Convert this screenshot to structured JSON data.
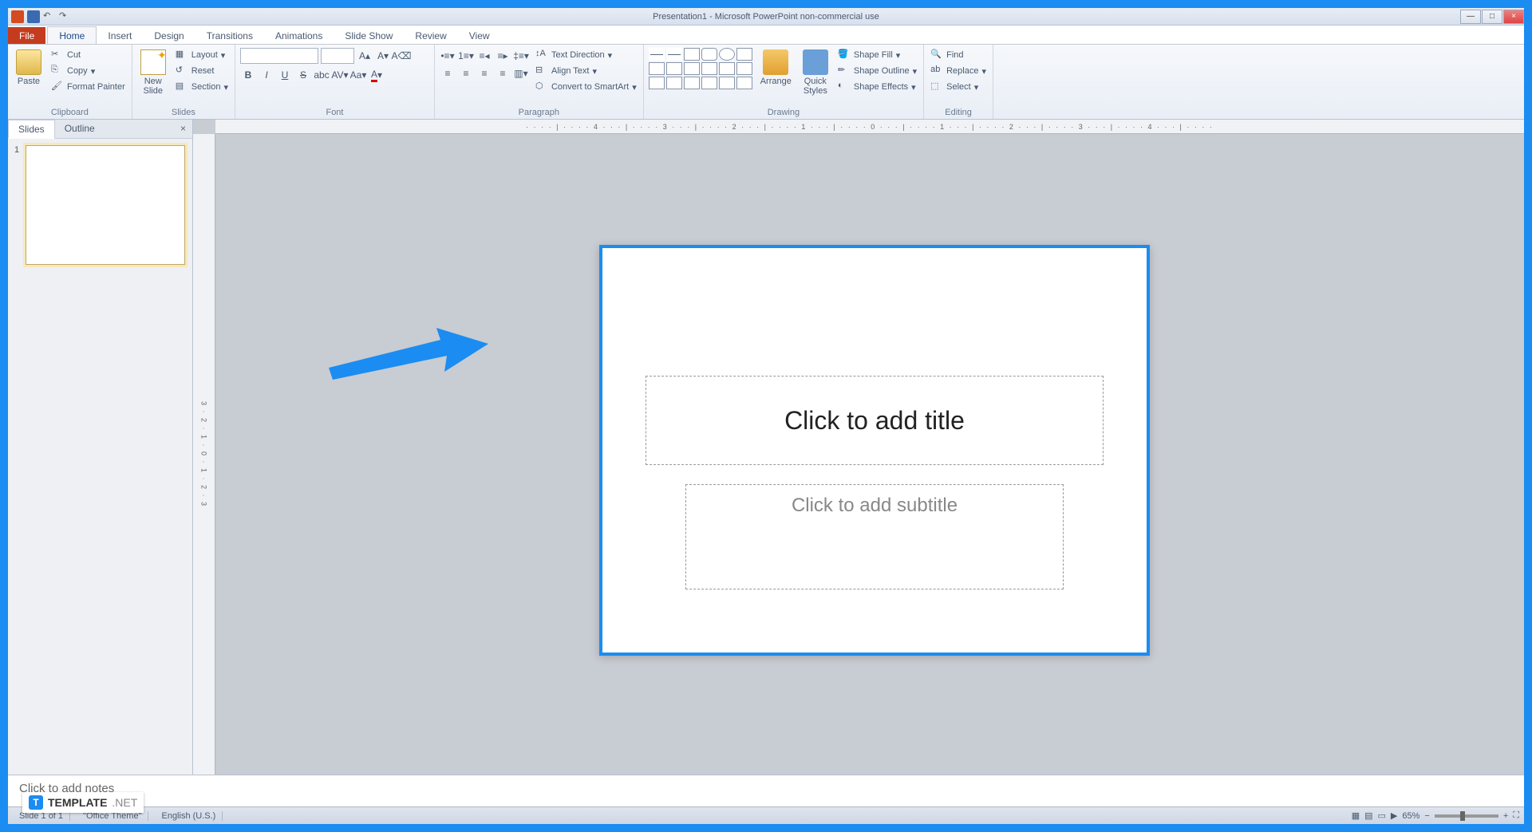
{
  "title_bar": {
    "title": "Presentation1 - Microsoft PowerPoint non-commercial use"
  },
  "tabs": {
    "file": "File",
    "items": [
      "Home",
      "Insert",
      "Design",
      "Transitions",
      "Animations",
      "Slide Show",
      "Review",
      "View"
    ],
    "active": 0
  },
  "ribbon": {
    "clipboard": {
      "title": "Clipboard",
      "paste": "Paste",
      "cut": "Cut",
      "copy": "Copy",
      "format_painter": "Format Painter"
    },
    "slides": {
      "title": "Slides",
      "new_slide": "New\nSlide",
      "layout": "Layout",
      "reset": "Reset",
      "section": "Section"
    },
    "font": {
      "title": "Font",
      "font_name": "",
      "font_size": ""
    },
    "paragraph": {
      "title": "Paragraph",
      "text_direction": "Text Direction",
      "align_text": "Align Text",
      "convert_smartart": "Convert to SmartArt"
    },
    "drawing": {
      "title": "Drawing",
      "arrange": "Arrange",
      "quick_styles": "Quick\nStyles",
      "shape_fill": "Shape Fill",
      "shape_outline": "Shape Outline",
      "shape_effects": "Shape Effects"
    },
    "editing": {
      "title": "Editing",
      "find": "Find",
      "replace": "Replace",
      "select": "Select"
    }
  },
  "slide_panel": {
    "tab_slides": "Slides",
    "tab_outline": "Outline",
    "slide_number": "1"
  },
  "slide": {
    "title_placeholder": "Click to add title",
    "subtitle_placeholder": "Click to add subtitle"
  },
  "notes": {
    "placeholder": "Click to add notes"
  },
  "status": {
    "slide_info": "Slide 1 of 1",
    "theme": "\"Office Theme\"",
    "language": "English (U.S.)",
    "zoom": "65%"
  },
  "ruler_h": "· · · · | · · · · 4 · · · | · · · · 3 · · · | · · · · 2 · · · | · · · · 1 · · · | · · · · 0 · · · | · · · · 1 · · · | · · · · 2 · · · | · · · · 3 · · · | · · · · 4 · · · | · · · ·",
  "ruler_v": "3 · 2 · 1 · 0 · 1 · 2 · 3",
  "watermark": {
    "brand": "TEMPLATE",
    "suffix": ".NET"
  }
}
